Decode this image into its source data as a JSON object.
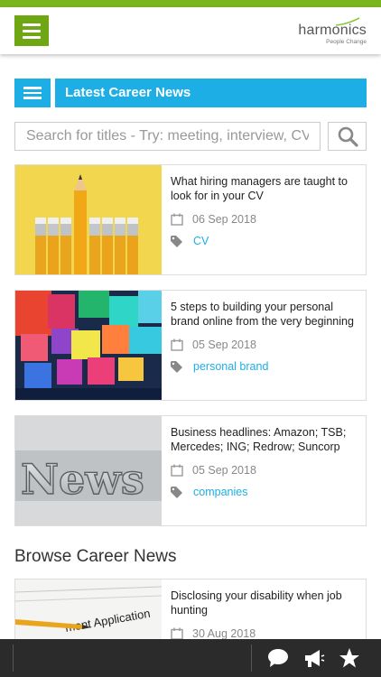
{
  "header": {
    "logo_text": "harmonics",
    "logo_tagline": "People Change"
  },
  "latest": {
    "title": "Latest Career News"
  },
  "search": {
    "placeholder": "Search for titles - Try: meeting, interview, CV..."
  },
  "articles": [
    {
      "title": "What hiring managers are taught to look for in your CV",
      "date": "06 Sep 2018",
      "tag": "CV",
      "image": "pencils"
    },
    {
      "title": "5 steps to building your personal brand online from the very beginning",
      "date": "05 Sep 2018",
      "tag": "personal brand",
      "image": "colored-blocks"
    },
    {
      "title": "Business headlines: Amazon; TSB; Mercedes; ING; Redrow; Suncorp",
      "date": "05 Sep 2018",
      "tag": "companies",
      "image": "news-letterpress",
      "image_text": "News"
    }
  ],
  "browse": {
    "title": "Browse Career News",
    "articles": [
      {
        "title": "Disclosing your disability when job hunting",
        "date": "30 Aug 2018",
        "image": "application-form",
        "image_text": "ment Application"
      }
    ]
  },
  "colors": {
    "brand_green": "#7ab51d",
    "accent_blue": "#1daee6",
    "bottom_bar": "#2b2b2b"
  },
  "icons": [
    "menu-icon",
    "list-icon",
    "search-icon",
    "calendar-icon",
    "tag-icon",
    "chat-icon",
    "megaphone-icon",
    "star-icon"
  ]
}
